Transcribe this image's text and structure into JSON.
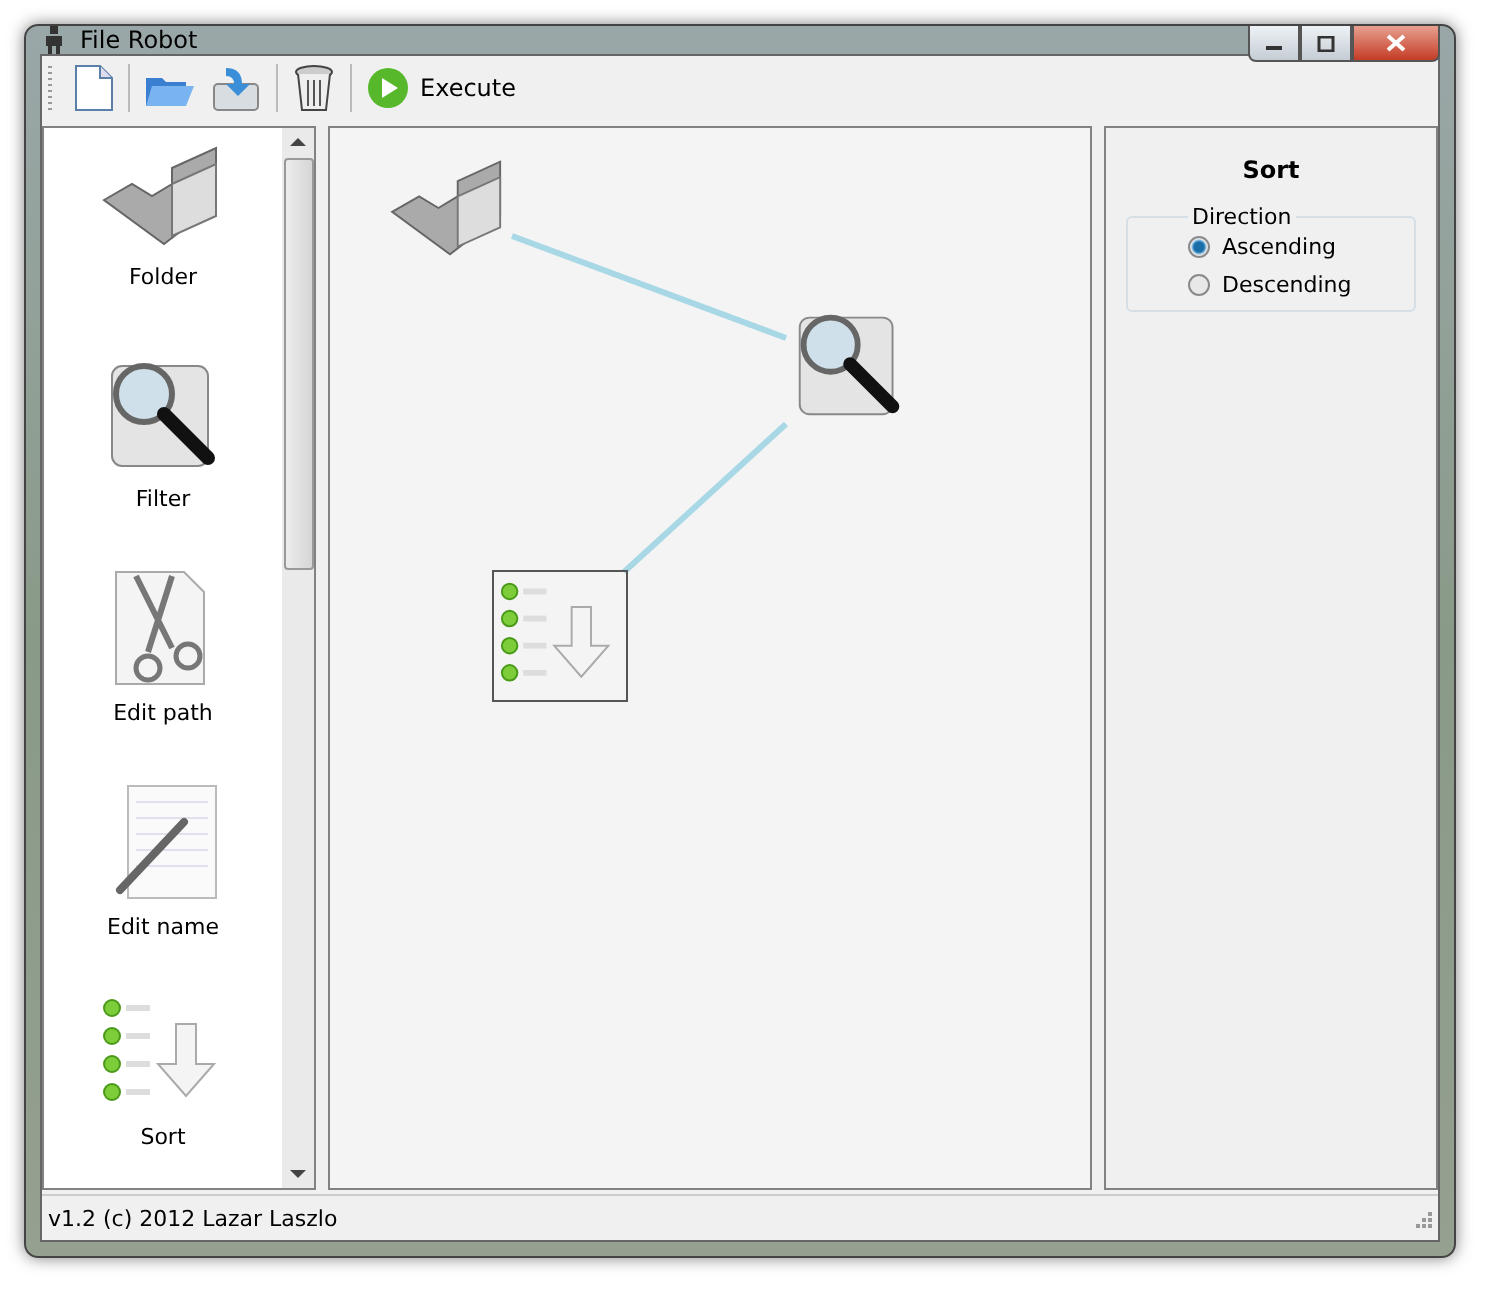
{
  "window": {
    "title": "File Robot"
  },
  "toolbar": [
    {
      "kind": "new"
    },
    {
      "kind": "open"
    },
    {
      "kind": "save"
    },
    {
      "kind": "delete"
    },
    {
      "kind": "execute",
      "label": "Execute"
    }
  ],
  "palette": [
    {
      "kind": "folder",
      "label": "Folder"
    },
    {
      "kind": "filter",
      "label": "Filter"
    },
    {
      "kind": "editpath",
      "label": "Edit path"
    },
    {
      "kind": "editname",
      "label": "Edit name"
    },
    {
      "kind": "sort",
      "label": "Sort"
    }
  ],
  "canvas": {
    "nodes": [
      {
        "kind": "folder",
        "selected": false
      },
      {
        "kind": "filter",
        "selected": false
      },
      {
        "kind": "sort",
        "selected": true
      }
    ]
  },
  "properties": {
    "title": "Sort",
    "group": "Direction",
    "options": [
      {
        "label": "Ascending",
        "selected": true
      },
      {
        "label": "Descending",
        "selected": false
      }
    ]
  },
  "status_bar": {
    "text": "v1.2 (c) 2012 Lazar Laszlo"
  }
}
